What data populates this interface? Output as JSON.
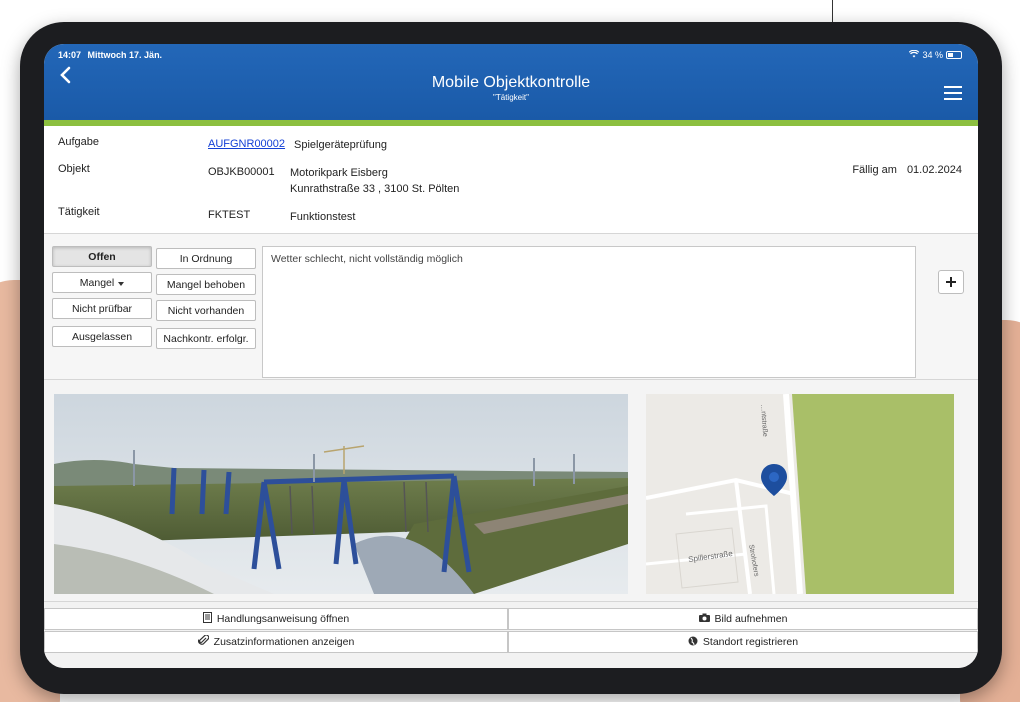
{
  "status_bar": {
    "time": "14:07",
    "date": "Mittwoch 17. Jän.",
    "battery": "34 %",
    "battery_level": 0.34
  },
  "header": {
    "title": "Mobile Objektkontrolle",
    "subtitle": "\"Tätigkeit\""
  },
  "info": {
    "aufgabe_label": "Aufgabe",
    "aufgabe_code": "AUFGNR00002",
    "aufgabe_text": "Spielgeräteprüfung",
    "objekt_label": "Objekt",
    "objekt_code": "OBJKB00001",
    "objekt_name": "Motorikpark Eisberg",
    "objekt_address": "Kunrathstraße 33 , 3100 St. Pölten",
    "taetigkeit_label": "Tätigkeit",
    "taetigkeit_code": "FKTEST",
    "taetigkeit_text": "Funktionstest",
    "due_label": "Fällig am",
    "due_date": "01.02.2024"
  },
  "status_buttons": {
    "offen": "Offen",
    "in_ordnung": "In Ordnung",
    "mangel": "Mangel",
    "mangel_behoben": "Mangel behoben",
    "nicht_pruefbar": "Nicht prüfbar",
    "nicht_vorhanden": "Nicht vorhanden",
    "ausgelassen": "Ausgelassen",
    "nachkontr": "Nachkontr. erfolgr."
  },
  "comment": {
    "value": "Wetter schlecht, nicht vollständig möglich"
  },
  "map": {
    "street_top": "…ntstraße",
    "street_spiller": "Spillerstraße",
    "street_stro": "Strohofers"
  },
  "actions": {
    "handlungsanweisung": "Handlungsanweisung öffnen",
    "zusatzinformationen": "Zusatzinformationen anzeigen",
    "bild_aufnehmen": "Bild aufnehmen",
    "standort_registrieren": "Standort registrieren"
  },
  "colors": {
    "header_blue": "#1f63b3",
    "header_accent": "#8cbf3f",
    "map_park": "#a9bf68",
    "marker": "#1d4e9e",
    "link": "#1440d6"
  }
}
